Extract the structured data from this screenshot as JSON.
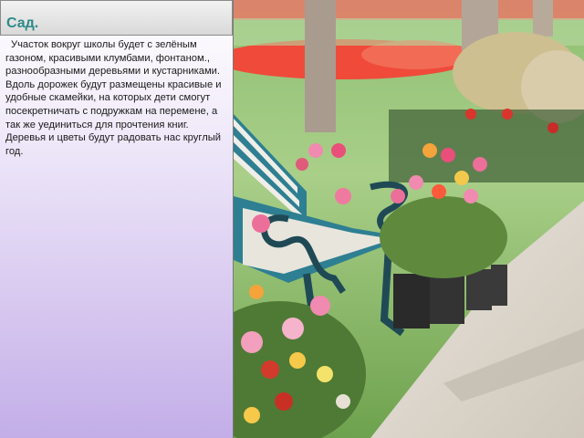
{
  "slide": {
    "title": "Сад.",
    "body": "Участок вокруг школы будет  с зелёным газоном, красивыми клумбами, фонтаном., разнообразными деревьями и кустарниками. Вдоль дорожек будут размещены красивые и удобные скамейки,  на которых дети смогут посекретничать с подружкам на перемене, а так же уединиться для прочтения книг. Деревья и цветы будут радовать нас круглый год."
  },
  "photo": {
    "subject": "garden-bench-with-tulips"
  }
}
